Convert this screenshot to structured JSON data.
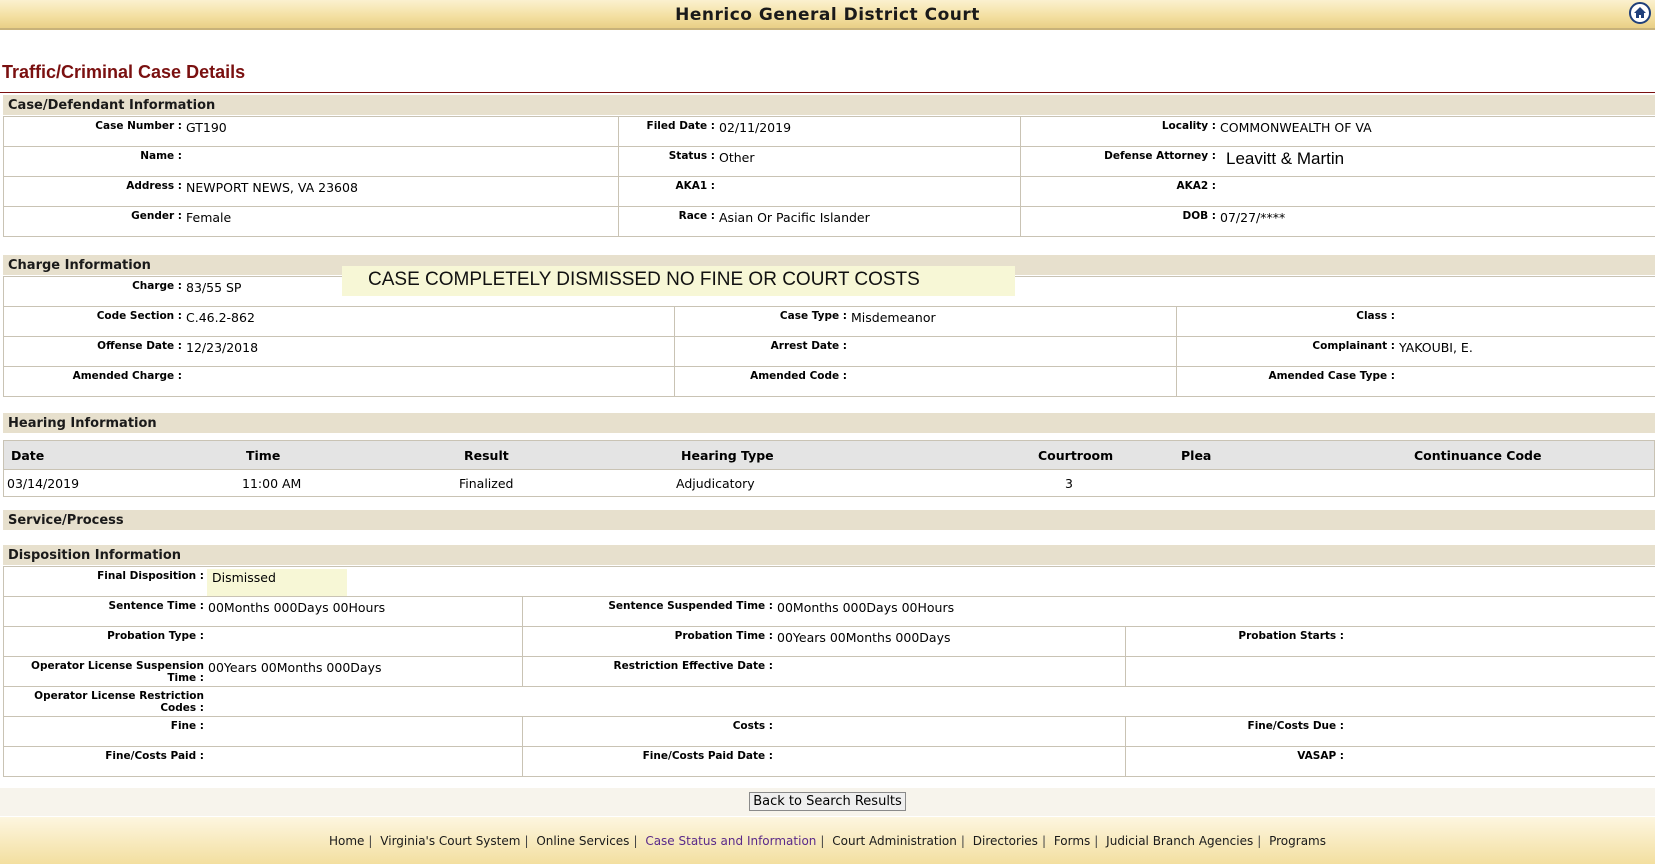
{
  "header": {
    "title": "Henrico General District Court",
    "home_icon": "home-icon"
  },
  "page_title": "Traffic/Criminal Case Details",
  "case_section": {
    "heading": "Case/Defendant Information",
    "case_number_label": "Case Number :",
    "case_number": "GT190",
    "filed_date_label": "Filed Date :",
    "filed_date": "02/11/2019",
    "locality_label": "Locality :",
    "locality": "COMMONWEALTH OF VA",
    "name_label": "Name :",
    "name": "",
    "status_label": "Status :",
    "status": "Other",
    "defense_attorney_label": "Defense Attorney :",
    "defense_attorney": "Leavitt & Martin",
    "address_label": "Address :",
    "address": "NEWPORT NEWS, VA 23608",
    "aka1_label": "AKA1 :",
    "aka1": "",
    "aka2_label": "AKA2 :",
    "aka2": "",
    "gender_label": "Gender :",
    "gender": "Female",
    "race_label": "Race :",
    "race": "Asian Or Pacific Islander",
    "dob_label": "DOB :",
    "dob": "07/27/****"
  },
  "charge_section": {
    "heading": "Charge Information",
    "charge_label": "Charge :",
    "charge": "83/55 SP",
    "note": "CASE COMPLETELY DISMISSED NO FINE OR COURT COSTS",
    "code_section_label": "Code Section :",
    "code_section": "C.46.2-862",
    "case_type_label": "Case Type :",
    "case_type": "Misdemeanor",
    "class_label": "Class :",
    "class": "",
    "offense_date_label": "Offense Date :",
    "offense_date": "12/23/2018",
    "arrest_date_label": "Arrest Date :",
    "arrest_date": "",
    "complainant_label": "Complainant :",
    "complainant": "YAKOUBI, E.",
    "amended_charge_label": "Amended Charge :",
    "amended_charge": "",
    "amended_code_label": "Amended Code :",
    "amended_code": "",
    "amended_case_type_label": "Amended Case Type :",
    "amended_case_type": ""
  },
  "hearing_section": {
    "heading": "Hearing Information",
    "columns": [
      "Date",
      "Time",
      "Result",
      "Hearing Type",
      "Courtroom",
      "Plea",
      "Continuance Code"
    ],
    "rows": [
      [
        "03/14/2019",
        "11:00 AM",
        "Finalized",
        "Adjudicatory",
        "3",
        "",
        ""
      ]
    ]
  },
  "service_section": {
    "heading": "Service/Process"
  },
  "disposition_section": {
    "heading": "Disposition Information",
    "final_disposition_label": "Final Disposition :",
    "final_disposition": "Dismissed",
    "sentence_time_label": "Sentence Time :",
    "sentence_time": "00Months 000Days 00Hours",
    "sentence_suspended_label": "Sentence Suspended Time :",
    "sentence_suspended": "00Months 000Days 00Hours",
    "probation_type_label": "Probation Type :",
    "probation_type": "",
    "probation_time_label": "Probation Time :",
    "probation_time": "00Years 00Months 000Days",
    "probation_starts_label": "Probation Starts :",
    "probation_starts": "",
    "ol_suspension_label": "Operator License Suspension Time :",
    "ol_suspension": "00Years 00Months 000Days",
    "restriction_effective_label": "Restriction Effective Date :",
    "restriction_effective": "",
    "ol_restriction_codes_label": "Operator License Restriction Codes :",
    "ol_restriction_codes": "",
    "fine_label": "Fine :",
    "fine": "",
    "costs_label": "Costs :",
    "costs": "",
    "fine_costs_due_label": "Fine/Costs Due :",
    "fine_costs_due": "",
    "fine_costs_paid_label": "Fine/Costs Paid :",
    "fine_costs_paid": "",
    "fine_costs_paid_date_label": "Fine/Costs Paid Date :",
    "fine_costs_paid_date": "",
    "vasap_label": "VASAP :",
    "vasap": ""
  },
  "back_button": "Back to Search Results",
  "footer": {
    "links": [
      "Home",
      "Virginia's Court System",
      "Online Services",
      "Case Status and Information",
      "Court Administration",
      "Directories",
      "Forms",
      "Judicial Branch Agencies",
      "Programs"
    ],
    "separator": "|"
  }
}
